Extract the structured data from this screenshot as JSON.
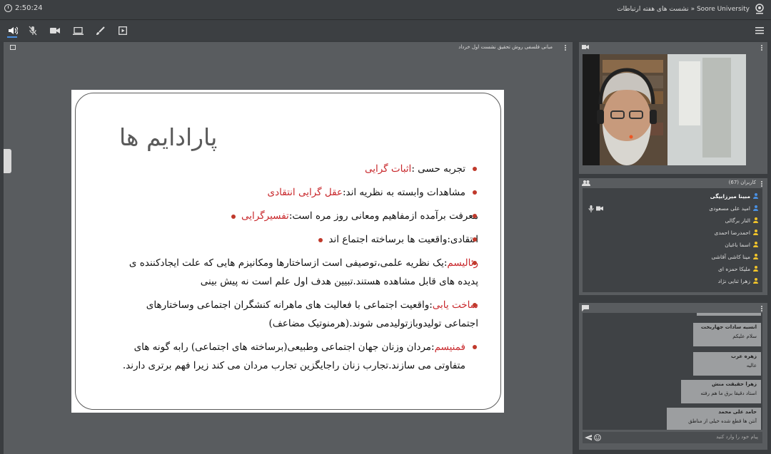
{
  "header": {
    "clock": "2:50:24",
    "title": "Soore University « نشست های هفته ارتباطات"
  },
  "presentation": {
    "title": "مبانی فلسفی روش تحقیق نشست اول خرداد",
    "slide_title": "پارادایم ها",
    "bullets": [
      {
        "pre": "تجربه حسی :",
        "hl": "اثبات گرایی",
        "post": ""
      },
      {
        "pre": "مشاهدات وابسته به نظریه اند:",
        "hl": "عقل گرایی انتقادی",
        "post": ""
      },
      {
        "pre": "معرفت برآمده ازمفاهیم ومعانی روز مره است:",
        "hl": "تفسیرگرایی",
        "post": ""
      },
      {
        "pre": "انتقادی:واقعیت ها برساخته اجتماع اند",
        "hl": "",
        "post": ""
      },
      {
        "pre": "",
        "hl": "رئالیسم",
        "post": ":یک نظریه علمی،توصیفی است ازساختارها ومکانیزم هایی که علت ایجادکننده ی پدیده های قابل مشاهده هستند.تبیین هدف اول علم است نه پیش بینی"
      },
      {
        "pre": "",
        "hl": "ساخت یابی",
        "post": ":واقعیت اجتماعی با فعالیت های ماهرانه کنشگران اجتماعی  وساختارهای اجتماعی تولیدوبازتولیدمی شوند.(هرمنوتیک مضاعف)"
      },
      {
        "pre": "",
        "hl": "فمنیسم",
        "post": ":مردان وزنان جهان اجتماعی وطبیعی(برساخته های اجتماعی) رابه  گونه های متفاوتی می سازند.تجارب زنان راجایگزین تجارب مردان می کند زیرا فهم برتری دارند."
      }
    ]
  },
  "users": {
    "title": "کاربران (67)",
    "list": [
      {
        "name": "مبینا میرزابیگی",
        "role": "presenter"
      },
      {
        "name": "امید علی مسعودی",
        "role": "host"
      },
      {
        "name": "النار برگالی",
        "role": "viewer"
      },
      {
        "name": "احمدرضا احمدی",
        "role": "viewer"
      },
      {
        "name": "اسما باغبان",
        "role": "viewer"
      },
      {
        "name": "مینا کاشی آقاشی",
        "role": "viewer"
      },
      {
        "name": "ملیکا حمزه ای",
        "role": "viewer"
      },
      {
        "name": "زهرا ثنایی نژاد",
        "role": "viewer"
      }
    ]
  },
  "chat": {
    "messages": [
      {
        "name": "انسیه سادات جهاربخت",
        "text": "سلام علیکم"
      },
      {
        "name": "زهره عرب",
        "text": "عالیه"
      },
      {
        "name": "زهرا حقیقت منش",
        "text": "استاد دقیقا برق ما هم رفته"
      },
      {
        "name": "حامد علی محمد",
        "text": "آنتن ها قطع شده خیلی از مناطق"
      }
    ],
    "placeholder": "پیام خود را وارد کنید"
  },
  "colors": {
    "accent": "#c8262a",
    "bullet": "#c0392b",
    "presenter": "#4a90e2",
    "viewer": "#f0c32a"
  }
}
